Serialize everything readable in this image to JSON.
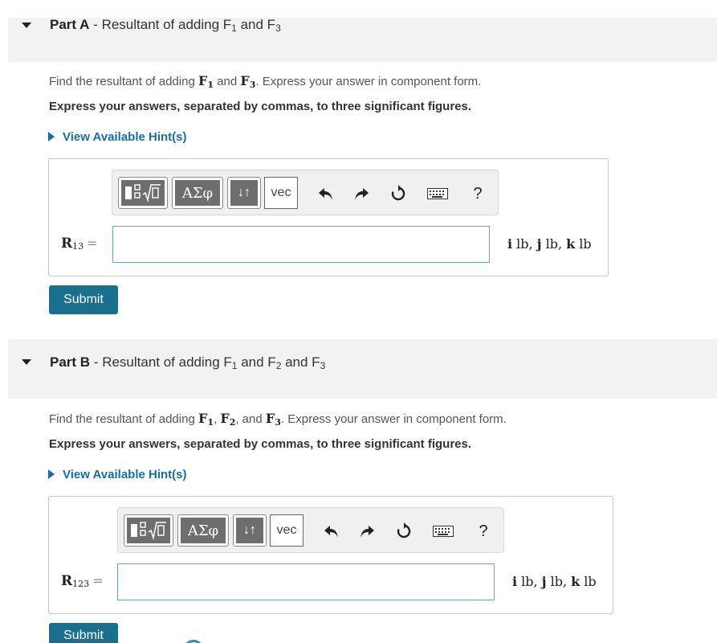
{
  "parts": [
    {
      "label": "Part A",
      "sep": " - ",
      "title_main": "Resultant of adding F",
      "title_sub1": "1",
      "title_mid": " and F",
      "title_sub2": "3",
      "question_pre": "Find the resultant of adding ",
      "question_vec1": "F",
      "question_vec1_sub": "1",
      "question_mid": " and ",
      "question_vec2": "F",
      "question_vec2_sub": "3",
      "question_post": ". Express your answer in component form.",
      "instruction": "Express your answers, separated by commas, to three significant figures.",
      "hint": "View Available Hint(s)",
      "var": "R",
      "var_sub": "13",
      "eq": "=",
      "input_value": "",
      "units": "i lb, j lb, k lb",
      "submit": "Submit"
    },
    {
      "label": "Part B",
      "sep": " - ",
      "title_main": "Resultant of adding F",
      "title_sub1": "1",
      "title_mid": " and F",
      "title_sub2": "2",
      "title_mid2": " and F",
      "title_sub3": "3",
      "question_pre": "Find the resultant of adding ",
      "question_vec1": "F",
      "question_vec1_sub": "1",
      "question_sep": ", ",
      "question_vec2": "F",
      "question_vec2_sub": "2",
      "question_mid": ", and ",
      "question_vec3": "F",
      "question_vec3_sub": "3",
      "question_post": ". Express your answer in component form.",
      "instruction": "Express your answers, separated by commas, to three significant figures.",
      "hint": "View Available Hint(s)",
      "var": "R",
      "var_sub": "123",
      "eq": "=",
      "input_value": "",
      "units": "i lb, j lb, k lb",
      "submit": "Submit"
    }
  ],
  "toolbar": {
    "templates_icon": "fraction-sqrt-icon",
    "greek": "ΑΣφ",
    "arrows": "↓↑",
    "vec": "vec",
    "undo_icon": "undo-icon",
    "redo_icon": "redo-icon",
    "reset_icon": "reset-icon",
    "keyboard_icon": "keyboard-icon",
    "help": "?"
  },
  "colors": {
    "link": "#1a6da4",
    "submit_bg": "#1a6f8f",
    "header_bg": "#f2f2f2",
    "input_border": "#6f9fcf"
  }
}
